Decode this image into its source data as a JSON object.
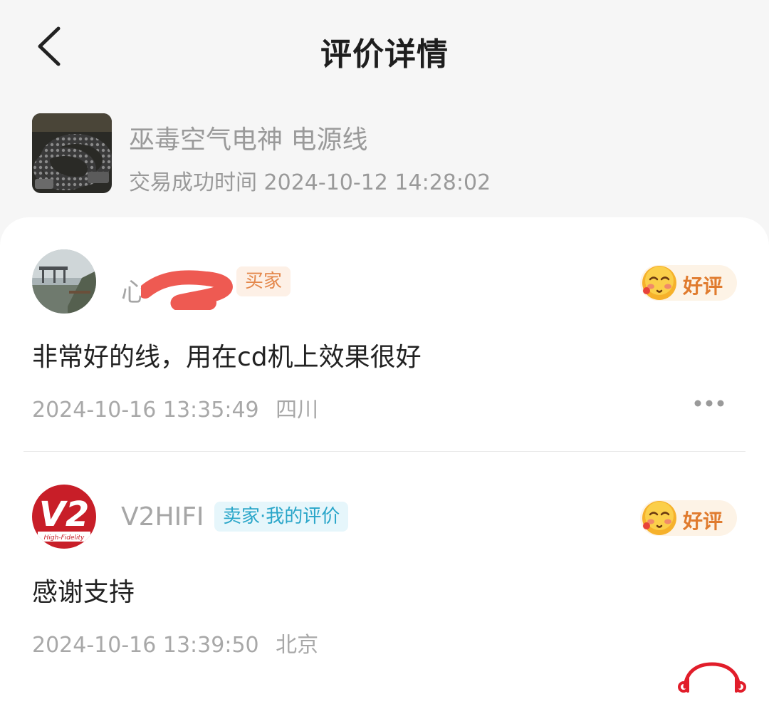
{
  "header": {
    "title": "评价详情",
    "back_icon": "chevron-left-icon"
  },
  "product": {
    "name": "巫毒空气电神 电源线",
    "trade_time": "交易成功时间 2024-10-12 14:28:02"
  },
  "reviews": [
    {
      "user": "心",
      "tag": "买家",
      "rating": "好评",
      "content": "非常好的线，用在cd机上效果很好",
      "time": "2024-10-16 13:35:49",
      "location": "四川"
    },
    {
      "user": "V2HIFI",
      "tag": "卖家·我的评价",
      "rating": "好评",
      "content": "感谢支持",
      "time": "2024-10-16 13:39:50",
      "location": "北京",
      "avatar_logo": "V2",
      "avatar_subtext": "High-Fidelity"
    }
  ],
  "colors": {
    "buyer_tag": "#e4884c",
    "seller_tag": "#2aa6c9",
    "rating": "#e07b2e",
    "brand_mark": "#e11d2a"
  }
}
